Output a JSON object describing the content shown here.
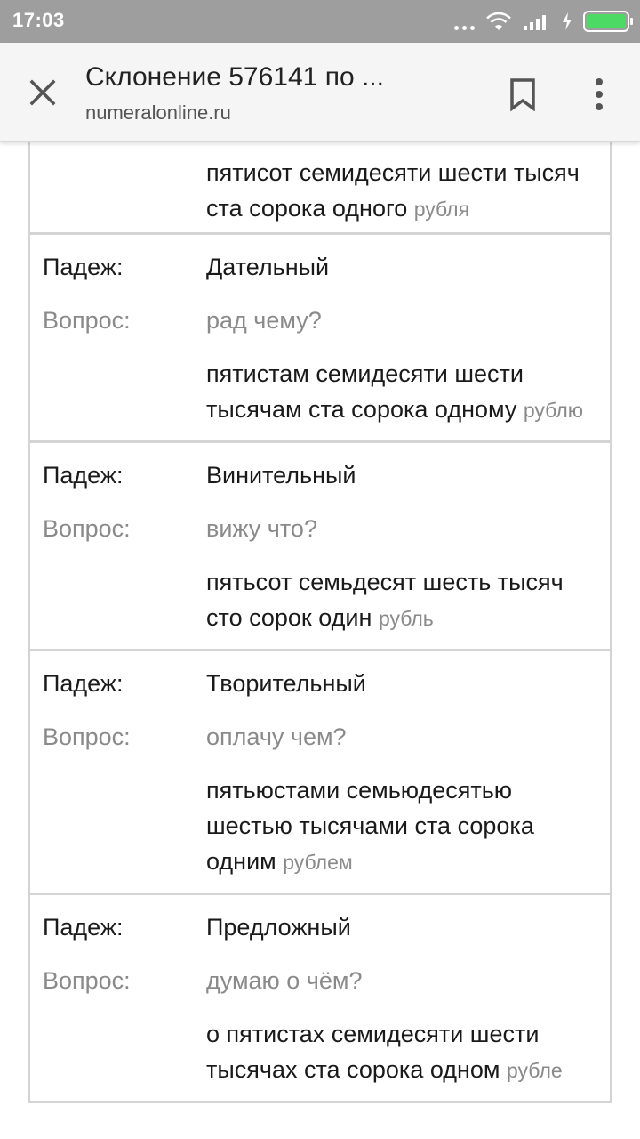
{
  "status_bar": {
    "time": "17:03",
    "battery_color": "#4cd964"
  },
  "toolbar": {
    "title": "Склонение 576141 по ...",
    "url": "numeralonline.ru",
    "icons": [
      "close-icon",
      "bookmark-icon",
      "more-vert-icon"
    ]
  },
  "partial_row": {
    "form": "пятисот семидесяти шести тысяч ста сорока одного",
    "unit": "рубля"
  },
  "rows": [
    {
      "case_label": "Падеж:",
      "case": "Дательный",
      "question_label": "Вопрос:",
      "question": "рад чему?",
      "form": "пятистам семидесяти шести тысячам ста сорока одному",
      "unit": "рублю"
    },
    {
      "case_label": "Падеж:",
      "case": "Винительный",
      "question_label": "Вопрос:",
      "question": "вижу что?",
      "form": "пятьсот семьдесят шесть тысяч сто сорок один",
      "unit": "рубль"
    },
    {
      "case_label": "Падеж:",
      "case": "Творительный",
      "question_label": "Вопрос:",
      "question": "оплачу чем?",
      "form": "пятьюстами семьюдесятью шестью тысячами ста сорока одним",
      "unit": "рублем"
    },
    {
      "case_label": "Падеж:",
      "case": "Предложный",
      "question_label": "Вопрос:",
      "question": "думаю о чём?",
      "form": "о пятистах семидесяти шести тысячах ста сорока одном",
      "unit": "рубле"
    }
  ]
}
